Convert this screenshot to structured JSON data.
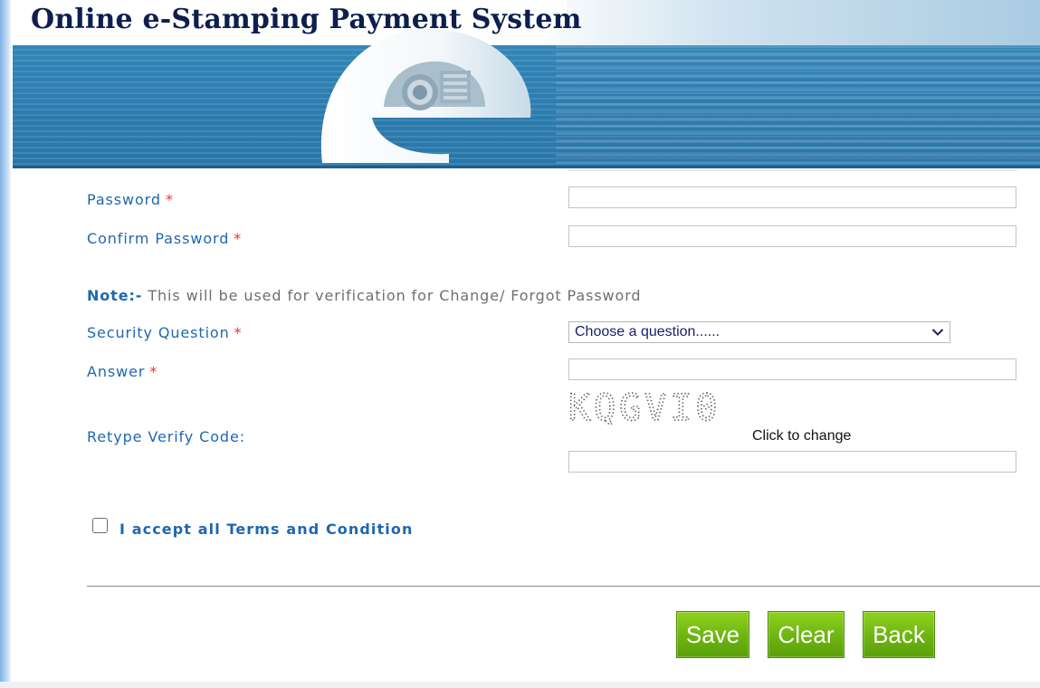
{
  "header": {
    "title": "Online e-Stamping Payment System",
    "logo_icon": "e-logo"
  },
  "form": {
    "password": {
      "label": "Password",
      "required_mark": "*",
      "value": ""
    },
    "confirm_password": {
      "label": "Confirm Password",
      "required_mark": "*",
      "value": ""
    },
    "note": {
      "prefix": "Note:-",
      "text": "This will be used for verification for Change/ Forgot Password"
    },
    "security_question": {
      "label": "Security Question",
      "required_mark": "*",
      "selected": "Choose a question......"
    },
    "answer": {
      "label": "Answer",
      "required_mark": "*",
      "value": ""
    },
    "verify": {
      "label": "Retype Verify Code:",
      "captcha_text": "KQGVI0",
      "change_link": "Click to change",
      "value": ""
    },
    "terms": {
      "label": "I accept all Terms and Condition",
      "checked": false
    }
  },
  "buttons": {
    "save": "Save",
    "clear": "Clear",
    "back": "Back"
  },
  "colors": {
    "label_blue": "#1f67b1",
    "required_red": "#e8342e",
    "button_green": "#6eb411",
    "banner_blue": "#2f80b3"
  }
}
